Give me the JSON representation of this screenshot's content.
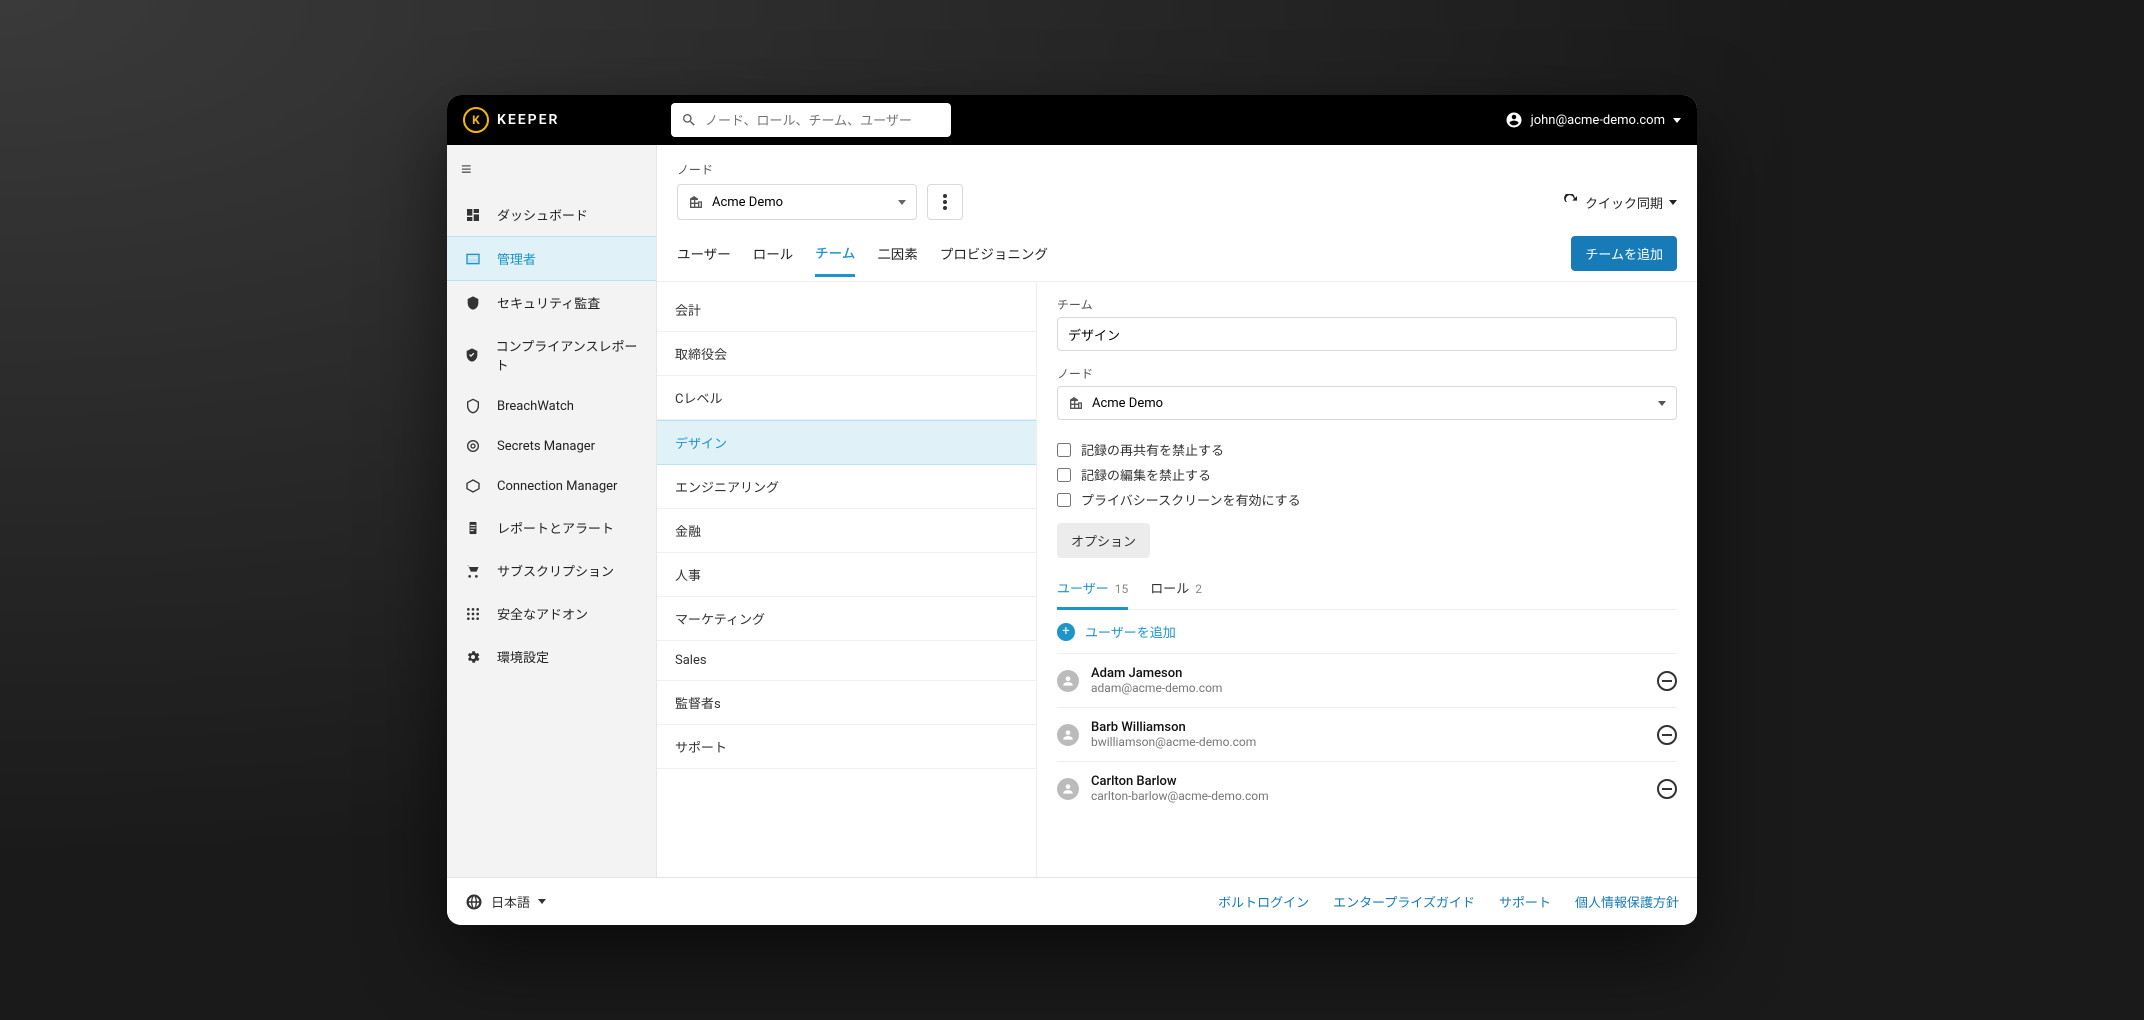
{
  "brand": "KEEPER",
  "search": {
    "placeholder": "ノード、ロール、チーム、ユーザー"
  },
  "user": {
    "email": "john@acme-demo.com"
  },
  "sidebar": {
    "items": [
      {
        "label": "ダッシュボード"
      },
      {
        "label": "管理者"
      },
      {
        "label": "セキュリティ監査"
      },
      {
        "label": "コンプライアンスレポート"
      },
      {
        "label": "BreachWatch"
      },
      {
        "label": "Secrets Manager"
      },
      {
        "label": "Connection Manager"
      },
      {
        "label": "レポートとアラート"
      },
      {
        "label": "サブスクリプション"
      },
      {
        "label": "安全なアドオン"
      },
      {
        "label": "環境設定"
      }
    ]
  },
  "node": {
    "label": "ノード",
    "selected": "Acme Demo"
  },
  "quick_sync": "クイック同期",
  "tabs": {
    "items": [
      {
        "label": "ユーザー"
      },
      {
        "label": "ロール"
      },
      {
        "label": "チーム"
      },
      {
        "label": "二因素"
      },
      {
        "label": "プロビジョニング"
      }
    ],
    "add_team": "チームを追加"
  },
  "teams": [
    {
      "name": "会計"
    },
    {
      "name": "取締役会"
    },
    {
      "name": "Cレベル"
    },
    {
      "name": "デザイン"
    },
    {
      "name": "エンジニアリング"
    },
    {
      "name": "金融"
    },
    {
      "name": "人事"
    },
    {
      "name": "マーケティング"
    },
    {
      "name": "Sales"
    },
    {
      "name": "監督者s"
    },
    {
      "name": "サポート"
    }
  ],
  "detail": {
    "team_label": "チーム",
    "team_name": "デザイン",
    "node_label": "ノード",
    "node_value": "Acme Demo",
    "checks": {
      "reshare": "記録の再共有を禁止する",
      "edit": "記録の編集を禁止する",
      "privacy": "プライバシースクリーンを有効にする"
    },
    "options": "オプション",
    "sub_tabs": {
      "users_label": "ユーザー",
      "users_count": "15",
      "roles_label": "ロール",
      "roles_count": "2"
    },
    "add_user": "ユーザーを追加",
    "members": [
      {
        "name": "Adam Jameson",
        "email": "adam@acme-demo.com"
      },
      {
        "name": "Barb Williamson",
        "email": "bwilliamson@acme-demo.com"
      },
      {
        "name": "Carlton Barlow",
        "email": "carlton-barlow@acme-demo.com"
      }
    ]
  },
  "footer": {
    "language": "日本語",
    "links": {
      "vault": "ボルトログイン",
      "enterprise_guide": "エンタープライズガイド",
      "support": "サポート",
      "privacy": "個人情報保護方針"
    }
  }
}
